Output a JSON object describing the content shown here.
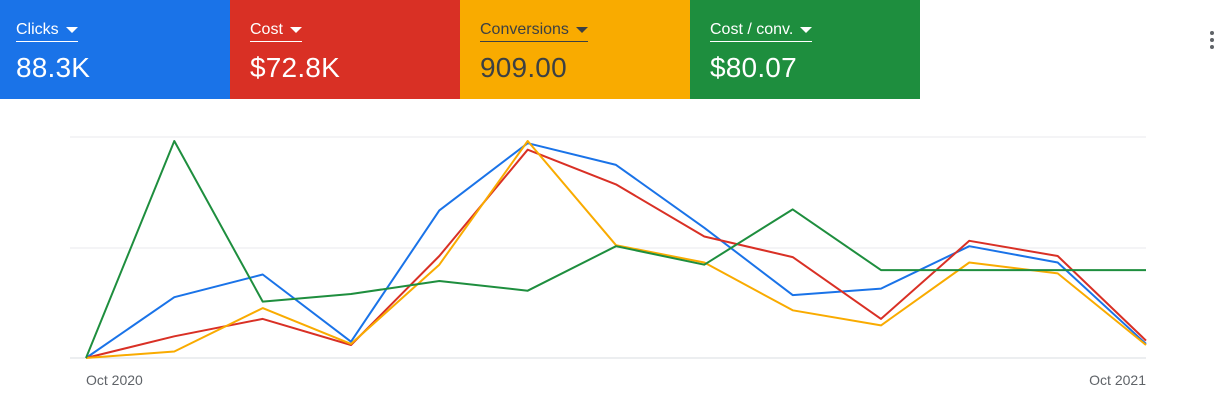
{
  "metrics": [
    {
      "label": "Clicks",
      "value": "88.3K",
      "color": "#1a73e8"
    },
    {
      "label": "Cost",
      "value": "$72.8K",
      "color": "#d93025"
    },
    {
      "label": "Conversions",
      "value": "909.00",
      "color": "#f9ab00"
    },
    {
      "label": "Cost / conv.",
      "value": "$80.07",
      "color": "#1e8e3e"
    }
  ],
  "chart_data": {
    "type": "line",
    "x_tick_labels": [
      "Oct 2020",
      "Oct 2021"
    ],
    "grid": true,
    "ylim": [
      0,
      1
    ],
    "series": [
      {
        "name": "Clicks",
        "color": "#1a73e8",
        "values": [
          0.0,
          0.28,
          0.385,
          0.075,
          0.68,
          0.99,
          0.89,
          0.6,
          0.29,
          0.32,
          0.515,
          0.44,
          0.065
        ]
      },
      {
        "name": "Cost",
        "color": "#d93025",
        "values": [
          0.0,
          0.1,
          0.18,
          0.06,
          0.47,
          0.96,
          0.8,
          0.56,
          0.465,
          0.18,
          0.54,
          0.47,
          0.08
        ]
      },
      {
        "name": "Conversions",
        "color": "#f9ab00",
        "values": [
          0.0,
          0.03,
          0.23,
          0.065,
          0.43,
          1.0,
          0.52,
          0.44,
          0.22,
          0.15,
          0.44,
          0.39,
          0.06
        ]
      },
      {
        "name": "Cost / conv.",
        "color": "#1e8e3e",
        "values": [
          0.0,
          1.0,
          0.26,
          0.295,
          0.355,
          0.31,
          0.515,
          0.43,
          0.685,
          0.405,
          0.405,
          0.405,
          0.405
        ]
      }
    ]
  }
}
